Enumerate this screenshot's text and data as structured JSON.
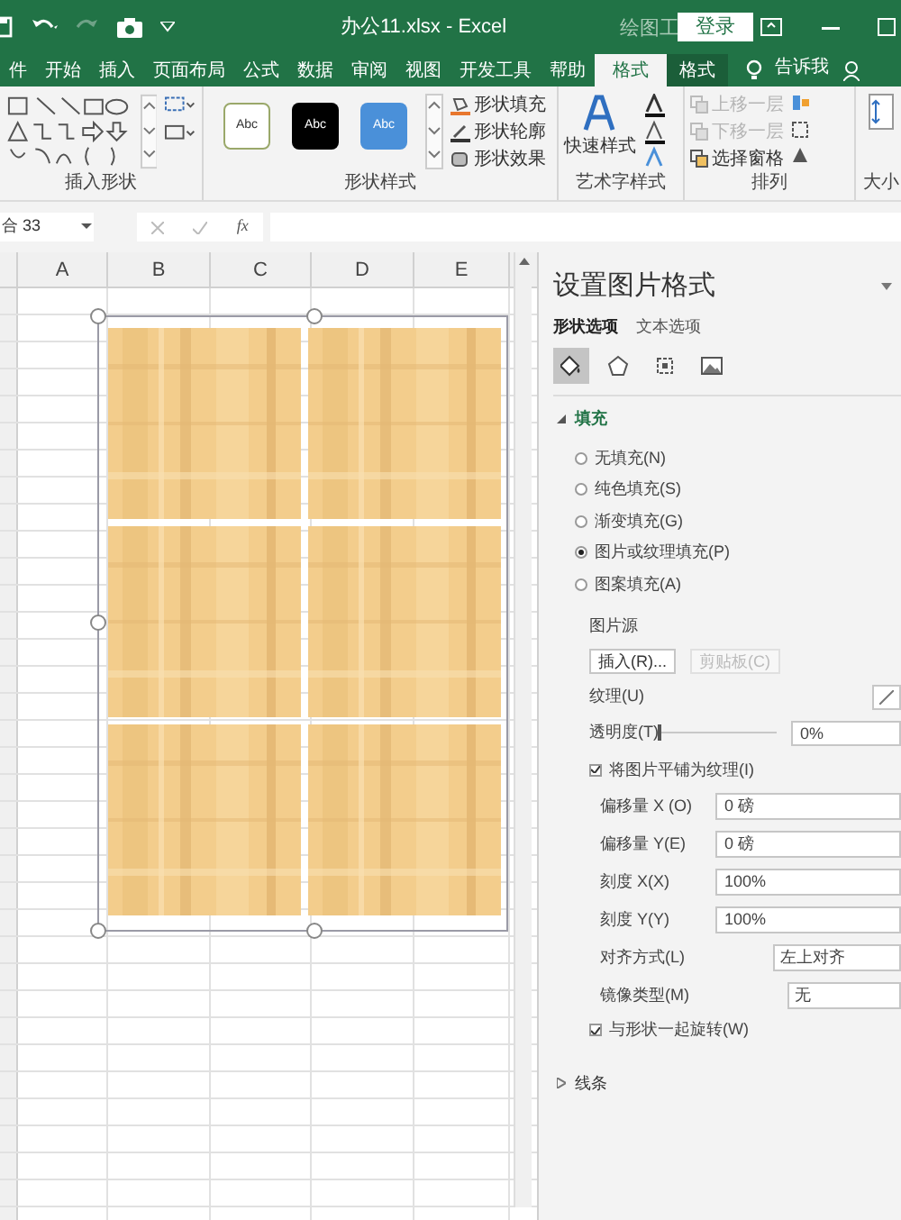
{
  "title_bar": {
    "title": "办公11.xlsx  -  Excel",
    "context_label": "绘图工",
    "sign_in": "登录"
  },
  "tabs": [
    {
      "label": "件",
      "selected": false
    },
    {
      "label": "开始",
      "selected": false
    },
    {
      "label": "插入",
      "selected": false
    },
    {
      "label": "页面布局",
      "selected": false
    },
    {
      "label": "公式",
      "selected": false
    },
    {
      "label": "数据",
      "selected": false
    },
    {
      "label": "审阅",
      "selected": false
    },
    {
      "label": "视图",
      "selected": false
    },
    {
      "label": "开发工具",
      "selected": false
    },
    {
      "label": "帮助",
      "selected": false
    },
    {
      "label": "格式",
      "selected": true
    },
    {
      "label": "格式",
      "selected": false
    }
  ],
  "tell_me": "告诉我",
  "ribbon": {
    "insert_shapes": {
      "label": "插入形状"
    },
    "shape_styles": {
      "label": "形状样式",
      "styles": [
        {
          "label": "Abc",
          "kind": "light"
        },
        {
          "label": "Abc",
          "kind": "dark"
        },
        {
          "label": "Abc",
          "kind": "accent"
        }
      ],
      "commands": [
        "形状填充",
        "形状轮廓",
        "形状效果"
      ]
    },
    "wordart_styles": {
      "label": "艺术字样式",
      "quick_styles": "快速样式"
    },
    "arrange": {
      "label": "排列",
      "commands": [
        {
          "label": "上移一层",
          "disabled": true
        },
        {
          "label": "下移一层",
          "disabled": true
        },
        {
          "label": "选择窗格",
          "disabled": false
        }
      ]
    },
    "size": {
      "label": "大小"
    }
  },
  "name_box": "合 33",
  "formula_bar": {
    "fx": "fx"
  },
  "columns": [
    "A",
    "B",
    "C",
    "D",
    "E"
  ],
  "pane": {
    "title": "设置图片格式",
    "tabs": [
      {
        "label": "形状选项",
        "selected": true
      },
      {
        "label": "文本选项",
        "selected": false
      }
    ],
    "icon_tabs": [
      {
        "kind": "fill",
        "selected": true
      },
      {
        "kind": "shape",
        "selected": false
      },
      {
        "kind": "size",
        "selected": false
      },
      {
        "kind": "picture",
        "selected": false
      }
    ],
    "fill": {
      "label": "填充",
      "expanded": true,
      "options": [
        {
          "label": "无填充(N)",
          "selected": false
        },
        {
          "label": "纯色填充(S)",
          "selected": false
        },
        {
          "label": "渐变填充(G)",
          "selected": false
        },
        {
          "label": "图片或纹理填充(P)",
          "selected": true
        },
        {
          "label": "图案填充(A)",
          "selected": false
        }
      ],
      "picture_source": "图片源",
      "insert": {
        "label": "插入(R)...",
        "disabled": false
      },
      "clipboard": {
        "label": "剪贴板(C)",
        "disabled": true
      },
      "texture": "纹理(U)",
      "transparency": {
        "label": "透明度(T)",
        "level": 0,
        "value": "0%"
      },
      "tile": {
        "label": "将图片平铺为纹理(I)",
        "checked": true
      },
      "fields": [
        {
          "label": "偏移量 X (O)",
          "value": "0 磅",
          "kind": "input"
        },
        {
          "label": "偏移量 Y(E)",
          "value": "0 磅",
          "kind": "input"
        },
        {
          "label": "刻度 X(X)",
          "value": "100%",
          "kind": "input"
        },
        {
          "label": "刻度 Y(Y)",
          "value": "100%",
          "kind": "input"
        },
        {
          "label": "对齐方式(L)",
          "value": "左上对齐",
          "kind": "dropdown"
        },
        {
          "label": "镜像类型(M)",
          "value": "无",
          "kind": "dropdown_small"
        }
      ],
      "rotate": {
        "label": "与形状一起旋转(W)",
        "checked": true
      }
    },
    "line": {
      "label": "线条",
      "expanded": false
    }
  }
}
